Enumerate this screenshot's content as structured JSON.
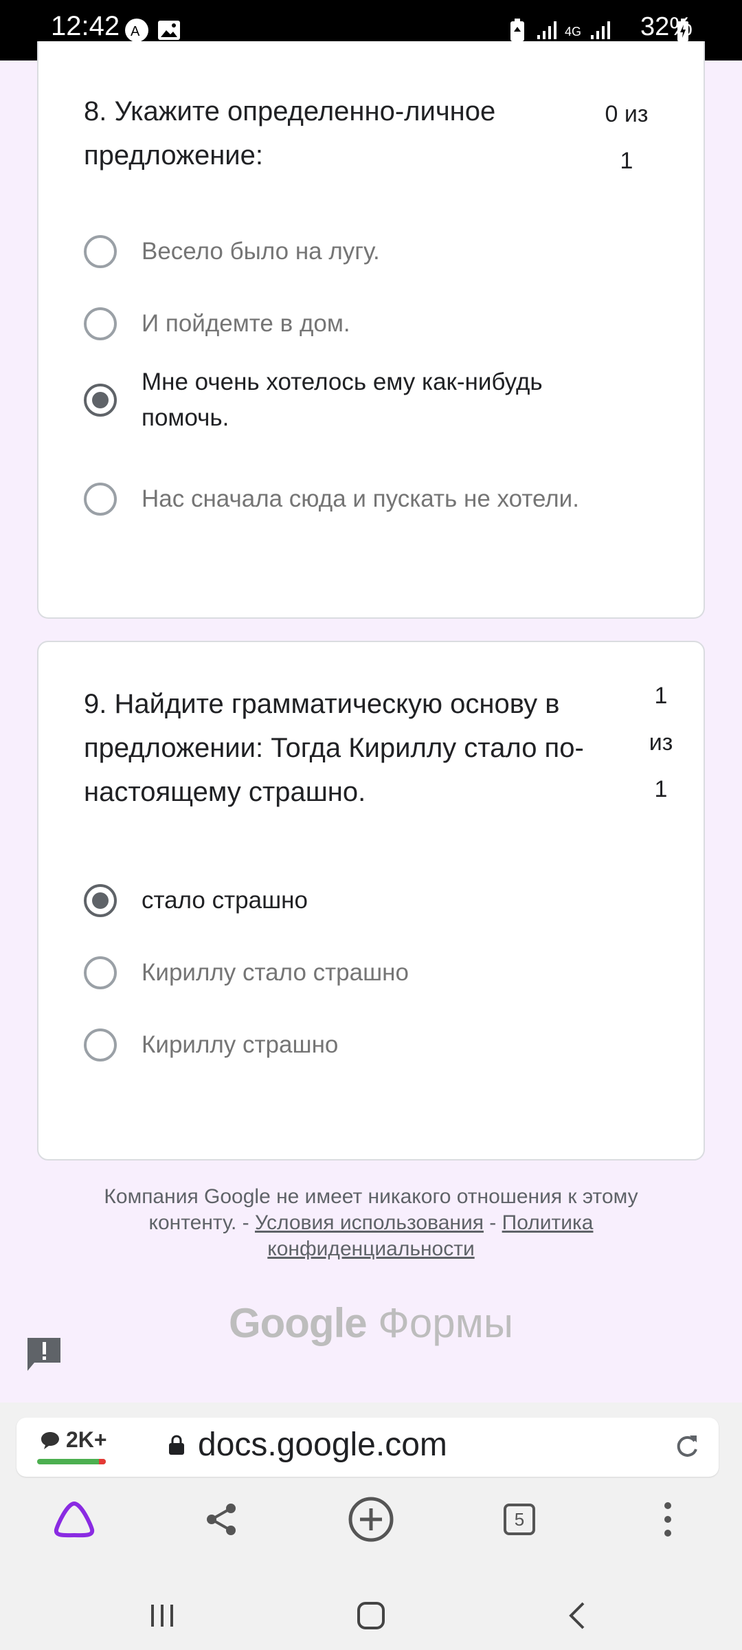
{
  "status_bar": {
    "time": "12:42",
    "network": "4G",
    "battery": "32%"
  },
  "questions": [
    {
      "title": "8. Укажите определенно-личное предложение:",
      "points_lines": [
        "0 из",
        "1"
      ],
      "options": [
        {
          "label": "Весело было на лугу.",
          "selected": false
        },
        {
          "label": "И пойдемте в дом.",
          "selected": false
        },
        {
          "label": "Мне очень хотелось ему как-нибудь помочь.",
          "selected": true
        },
        {
          "label": "Нас сначала сюда и пускать не хотели.",
          "selected": false
        }
      ]
    },
    {
      "title": "9. Найдите грамматическую основу в предложении: Тогда Кириллу стало по-настоящему страшно.",
      "points_lines": [
        "1",
        "из",
        "1"
      ],
      "options": [
        {
          "label": "стало страшно",
          "selected": true
        },
        {
          "label": "Кириллу стало страшно",
          "selected": false
        },
        {
          "label": "Кириллу страшно",
          "selected": false
        }
      ]
    }
  ],
  "footer": {
    "disclaimer": "Компания Google не имеет никакого отношения к этому контенту. -",
    "separator": "-",
    "terms_link": "Условия использования",
    "privacy_link": "Политика конфиденциальности",
    "brand_google": "Google",
    "brand_forms": "Формы"
  },
  "browser": {
    "comments_count": "2K+",
    "url": "docs.google.com",
    "tabs_count": "5"
  },
  "colors": {
    "page_bg": "#f8effd",
    "alice_purple": "#8a2be2",
    "radio_selected": "#5f6368",
    "radio_unselected": "#9aa0a6"
  }
}
